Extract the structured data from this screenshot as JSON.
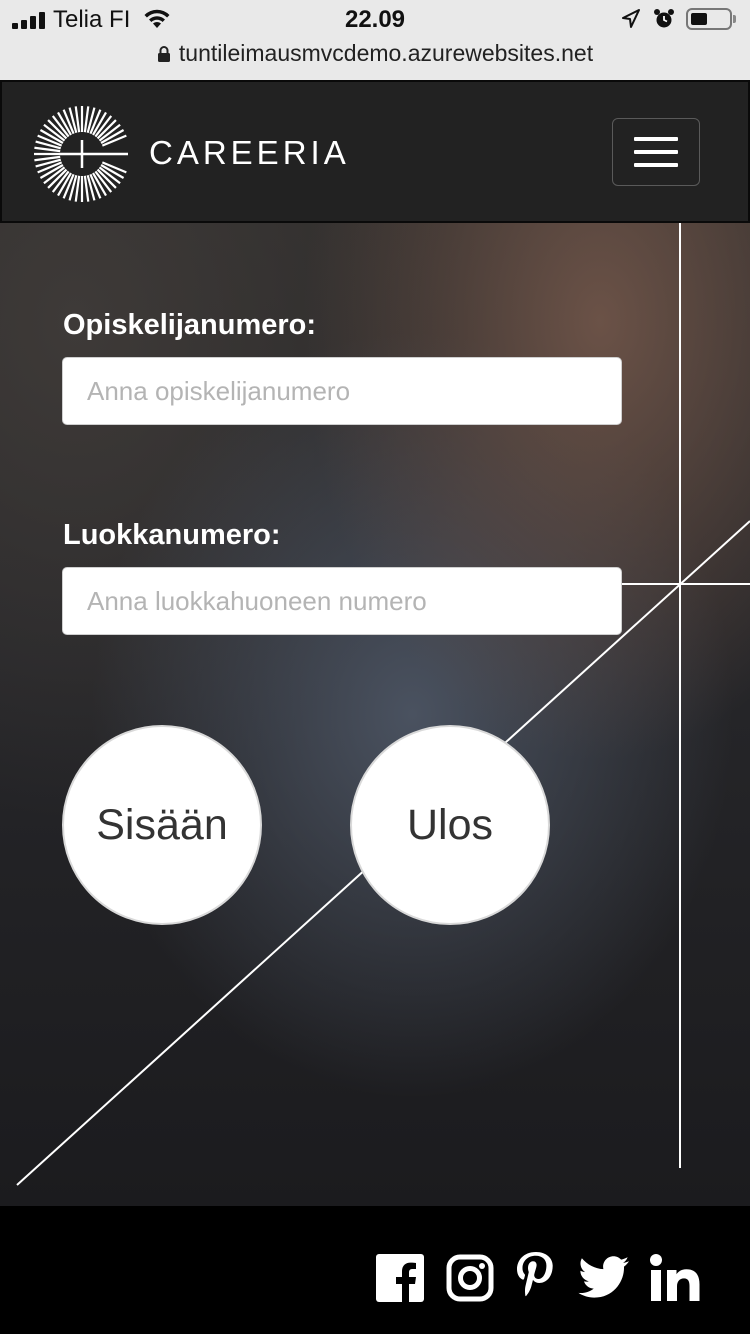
{
  "status_bar": {
    "carrier": "Telia FI",
    "time": "22.09",
    "battery_level": 0.45,
    "url": "tuntileimausmvcdemo.azurewebsites.net"
  },
  "navbar": {
    "brand": "CAREERIA"
  },
  "form": {
    "student_label": "Opiskelijanumero:",
    "student_placeholder": "Anna opiskelijanumero",
    "class_label": "Luokkanumero:",
    "class_placeholder": "Anna luokkahuoneen numero",
    "in_button": "Sisään",
    "out_button": "Ulos"
  },
  "footer": {
    "social_icons": [
      "facebook-icon",
      "instagram-icon",
      "pinterest-icon",
      "twitter-icon",
      "linkedin-icon"
    ]
  },
  "colors": {
    "navbar_bg": "#222222",
    "footer_bg": "#000000",
    "label_text": "#ffffff",
    "button_bg": "#ffffff"
  }
}
